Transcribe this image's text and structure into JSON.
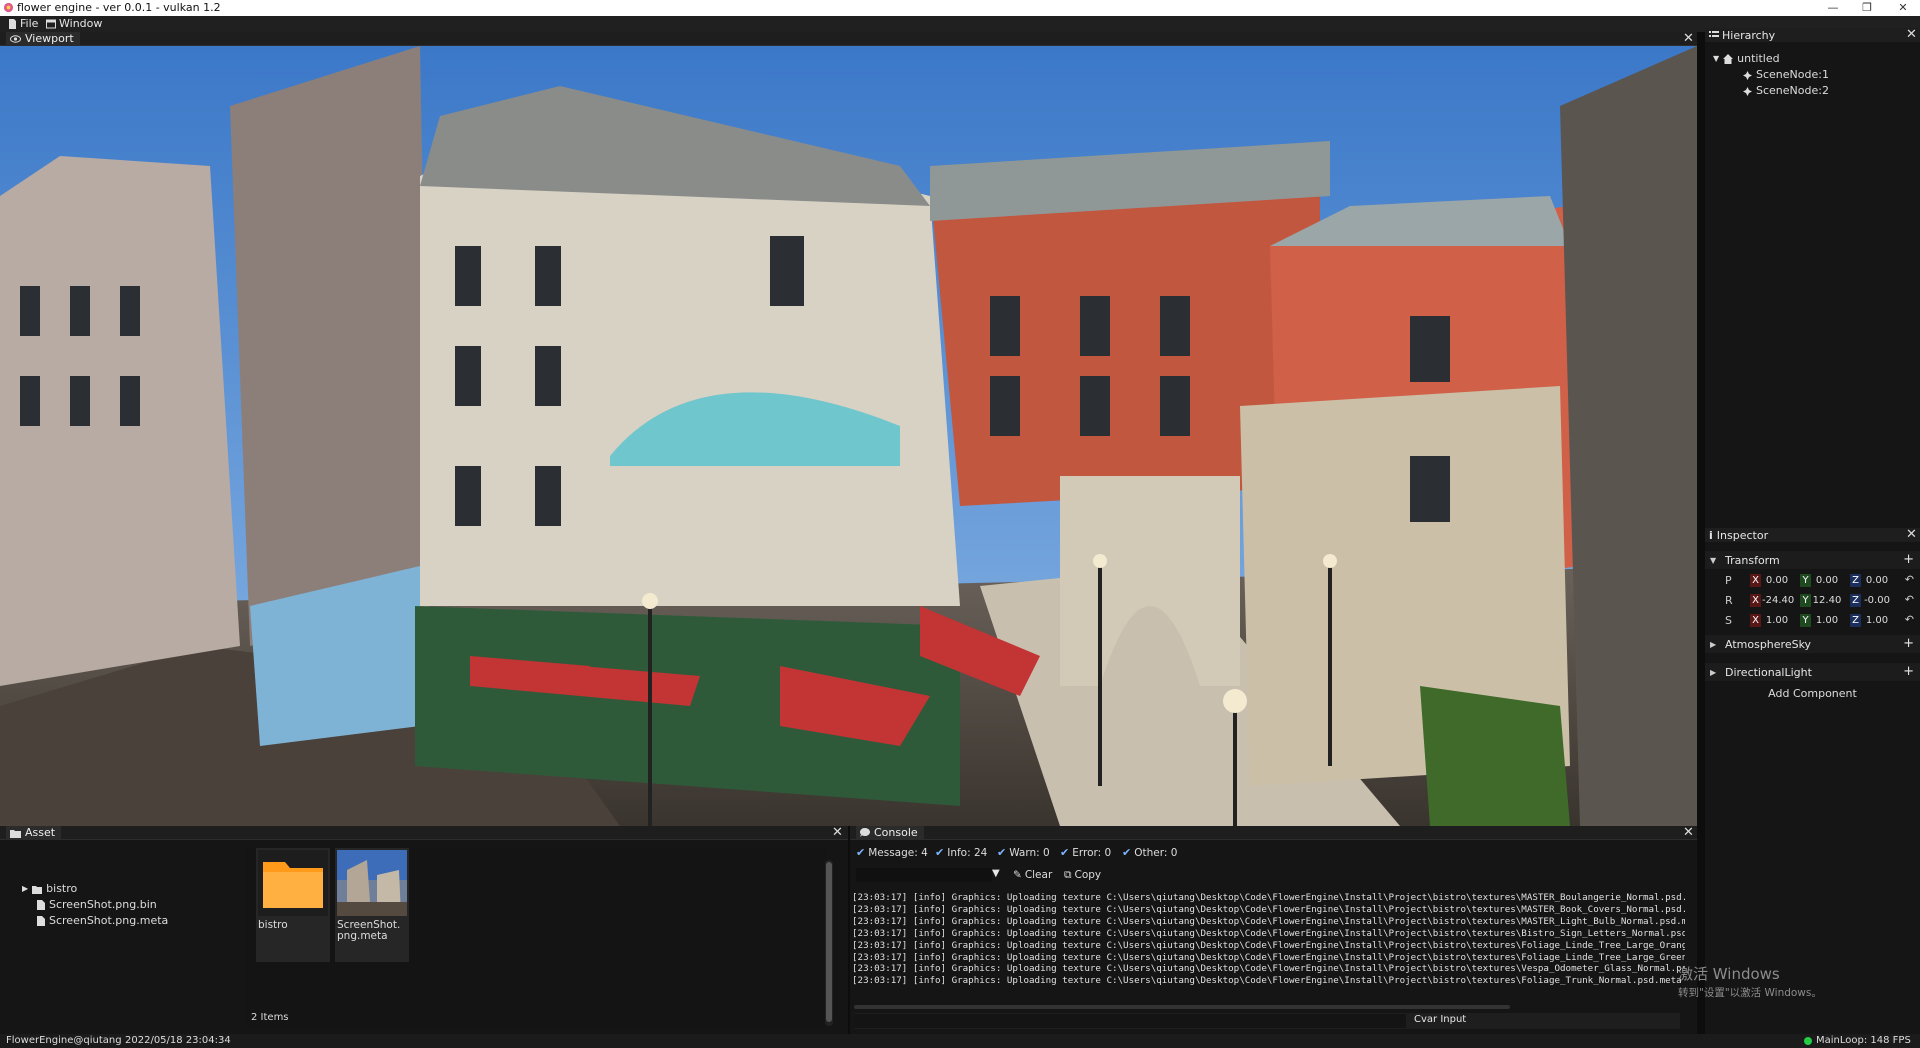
{
  "window": {
    "title": "flower engine - ver 0.0.1 - vulkan 1.2",
    "controls": {
      "minimize": "—",
      "maximize": "❐",
      "close": "✕"
    }
  },
  "menu": {
    "file": "File",
    "window": "Window"
  },
  "viewport": {
    "tab_label": "Viewport",
    "close": "✕"
  },
  "hierarchy": {
    "title": "Hierarchy",
    "close": "✕",
    "root": "untitled",
    "nodes": [
      "SceneNode:1",
      "SceneNode:2"
    ]
  },
  "inspector": {
    "title": "Inspector",
    "close": "✕",
    "transform": {
      "label": "Transform",
      "rows": [
        {
          "label": "P",
          "x": "0.00",
          "y": "0.00",
          "z": "0.00"
        },
        {
          "label": "R",
          "x": "-24.40",
          "y": "12.40",
          "z": "-0.00"
        },
        {
          "label": "S",
          "x": "1.00",
          "y": "1.00",
          "z": "1.00"
        }
      ],
      "axis_labels": {
        "x": "X",
        "y": "Y",
        "z": "Z"
      }
    },
    "components": [
      "AtmosphereSky",
      "DirectionalLight"
    ],
    "add_component": "Add Component",
    "plus": "+",
    "reset": "↶"
  },
  "asset": {
    "title": "Asset",
    "close": "✕",
    "tree": {
      "folder": "bistro",
      "files": [
        "ScreenShot.png.bin",
        "ScreenShot.png.meta"
      ]
    },
    "tiles": [
      {
        "caption": "bistro"
      },
      {
        "caption": "ScreenShot.\npng.meta"
      }
    ],
    "count": "2 Items"
  },
  "console": {
    "title": "Console",
    "close": "✕",
    "filters": [
      {
        "label": "Message: 4"
      },
      {
        "label": "Info: 24"
      },
      {
        "label": "Warn: 0"
      },
      {
        "label": "Error: 0"
      },
      {
        "label": "Other: 0"
      }
    ],
    "clear": "Clear",
    "copy": "Copy",
    "lines": [
      "[23:03:17] [info] Graphics: Uploading texture C:\\Users\\qiutang\\Desktop\\Code\\FlowerEngine\\Install\\Project\\bistro\\textures\\MASTER_Boulangerie_Normal.psd.meta to GPU and g",
      "[23:03:17] [info] Graphics: Uploading texture C:\\Users\\qiutang\\Desktop\\Code\\FlowerEngine\\Install\\Project\\bistro\\textures\\MASTER_Book_Covers_Normal.psd.meta to GPU and",
      "[23:03:17] [info] Graphics: Uploading texture C:\\Users\\qiutang\\Desktop\\Code\\FlowerEngine\\Install\\Project\\bistro\\textures\\MASTER_Light_Bulb_Normal.psd.meta to GPU and ge",
      "[23:03:17] [info] Graphics: Uploading texture C:\\Users\\qiutang\\Desktop\\Code\\FlowerEngine\\Install\\Project\\bistro\\textures\\Bistro_Sign_Letters_Normal.psd.meta to GPU and ge",
      "[23:03:17] [info] Graphics: Uploading texture C:\\Users\\qiutang\\Desktop\\Code\\FlowerEngine\\Install\\Project\\bistro\\textures\\Foliage_Linde_Tree_Large_Orange_Leaves_Normal.p",
      "[23:03:17] [info] Graphics: Uploading texture C:\\Users\\qiutang\\Desktop\\Code\\FlowerEngine\\Install\\Project\\bistro\\textures\\Foliage_Linde_Tree_Large_Green_Leaves_Normal.psc",
      "[23:03:17] [info] Graphics: Uploading texture C:\\Users\\qiutang\\Desktop\\Code\\FlowerEngine\\Install\\Project\\bistro\\textures\\Vespa_Odometer_Glass_Normal.psd.meta to GPU and",
      "[23:03:17] [info] Graphics: Uploading texture C:\\Users\\qiutang\\Desktop\\Code\\FlowerEngine\\Install\\Project\\bistro\\textures\\Foliage_Trunk_Normal.psd.meta to GPU and generate"
    ],
    "cvar_label": "Cvar Input"
  },
  "status": {
    "user": "FlowerEngine@qiutang",
    "datetime": "2022/05/18 23:04:34",
    "fps": "MainLoop: 148 FPS",
    "indicator_color": "#22cc44"
  },
  "watermark": {
    "line1": "激活 Windows",
    "line2": "转到\"设置\"以激活 Windows。"
  },
  "colors": {
    "panel_bg": "#151515",
    "header_bg": "#1e1e1e",
    "accent_check": "#7fb4ff",
    "folder_orange": "#ff9a1a"
  }
}
